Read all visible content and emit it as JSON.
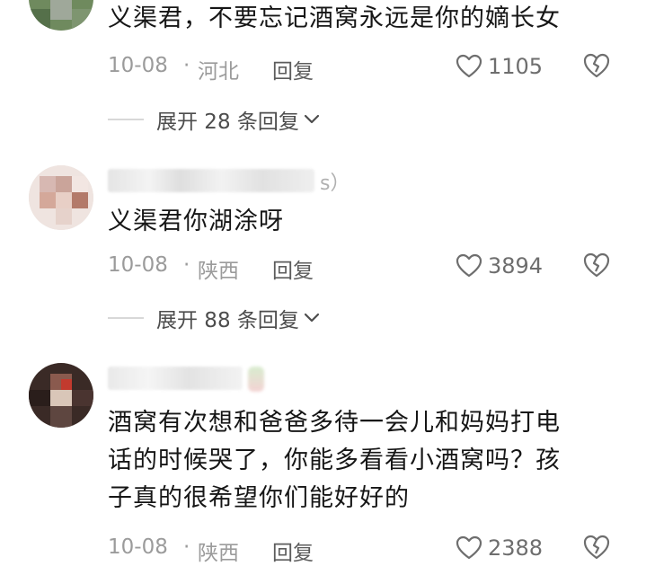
{
  "comments": [
    {
      "text": "义渠君，不要忘记酒窝永远是你的嫡长女",
      "date": "10-08",
      "separator": "·",
      "region": "河北",
      "reply_label": "回复",
      "likes": "1105",
      "expand_label": "展开 28 条回复"
    },
    {
      "username_tail": "s）",
      "text": "义渠君你湖涂呀",
      "date": "10-08",
      "separator": "·",
      "region": "陕西",
      "reply_label": "回复",
      "likes": "3894",
      "expand_label": "展开 88 条回复"
    },
    {
      "text_lines": [
        "酒窝有次想和爸爸多待一会儿和妈妈打电",
        "话的时候哭了，你能多看看小酒窝吗？孩",
        "子真的很希望你们能好好的"
      ],
      "date": "10-08",
      "separator": "·",
      "region": "陕西",
      "reply_label": "回复",
      "likes": "2388"
    }
  ],
  "icons": {
    "like": "heart-outline-icon",
    "dislike": "broken-heart-icon",
    "expand": "chevron-down-icon"
  },
  "colors": {
    "text": "#161616",
    "meta": "#9b9b9b",
    "reply": "#5c5c5c"
  }
}
